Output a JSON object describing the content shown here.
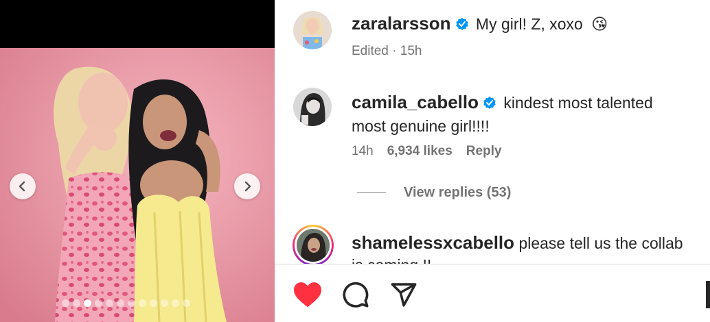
{
  "post": {
    "image_alt": "Two women posing together at a party, one in a pink leopard dress pointing at the camera and one in a yellow corset dress",
    "carousel": {
      "dot_count": 12,
      "active_index": 2
    }
  },
  "caption": {
    "username": "zaralarsson",
    "verified": true,
    "text": "My girl! Z, xoxo",
    "emoji": "😘",
    "meta": "Edited · 15h"
  },
  "comments": [
    {
      "username": "camila_cabello",
      "verified": true,
      "text_line1": "kindest most talented",
      "text_line2": "most genuine girl!!!!",
      "time": "14h",
      "likes": "6,934 likes",
      "reply_label": "Reply",
      "view_replies": "View replies (53)"
    },
    {
      "username": "shamelessxcabello",
      "verified": false,
      "text_line1": "please tell us the collab",
      "text_line2": "is coming !!"
    }
  ],
  "actions": {
    "like_icon": "heart-filled-icon",
    "comment_icon": "comment-icon",
    "share_icon": "paper-plane-icon",
    "like_color": "#ff3040"
  },
  "colors": {
    "verified": "#0095f6",
    "text": "#262626",
    "muted": "#737373"
  }
}
